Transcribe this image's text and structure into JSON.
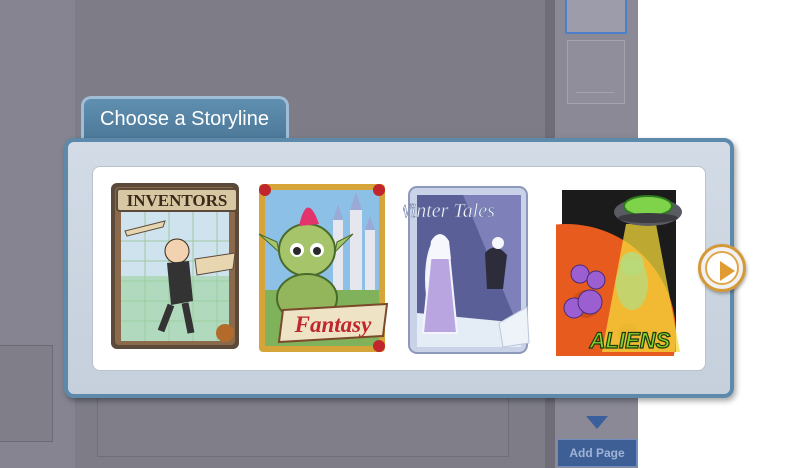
{
  "dialog": {
    "title": "Choose a Storyline",
    "next_icon": "play-arrow-icon"
  },
  "storylines": [
    {
      "title": "INVENTORS"
    },
    {
      "title": "Fantasy"
    },
    {
      "title": "Winter Tales"
    },
    {
      "title": "ALIENS"
    }
  ],
  "background": {
    "add_page_label": "Add Page"
  },
  "colors": {
    "tab": "#4c7797",
    "dialog_border": "#5d8aab",
    "next_ring": "#d49a3a",
    "add_page": "#3e5f96"
  }
}
